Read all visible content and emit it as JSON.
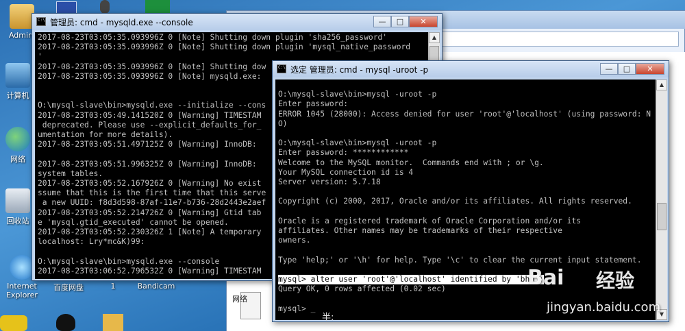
{
  "desktop": {
    "icons": [
      {
        "label": "Admini",
        "name": "desktop-icon-admin"
      },
      {
        "label": "计算机",
        "name": "desktop-icon-computer"
      },
      {
        "label": "网络",
        "name": "desktop-icon-network"
      },
      {
        "label": "回收站",
        "name": "desktop-icon-recycle-bin"
      },
      {
        "label": "Internet Explorer",
        "name": "desktop-icon-ie"
      },
      {
        "label": "百度网盘",
        "name": "desktop-icon-baidu-netdisk"
      },
      {
        "label": "1",
        "name": "desktop-icon-1"
      },
      {
        "label": "Bandicam",
        "name": "desktop-icon-bandicam"
      }
    ]
  },
  "explorer": {
    "file_label": "网络"
  },
  "window1": {
    "title": "管理员: cmd - mysqld.exe  --console",
    "lines": [
      "2017-08-23T03:05:35.093996Z 0 [Note] Shutting down plugin 'sha256_password'",
      "2017-08-23T03:05:35.093996Z 0 [Note] Shutting down plugin 'mysql_native_password",
      "'",
      "2017-08-23T03:05:35.093996Z 0 [Note] Shutting dow",
      "2017-08-23T03:05:35.093996Z 0 [Note] mysqld.exe:",
      "",
      "",
      "O:\\mysql-slave\\bin>mysqld.exe --initialize --cons",
      "2017-08-23T03:05:49.141520Z 0 [Warning] TIMESTAM",
      " deprecated. Please use --explicit_defaults_for_",
      "umentation for more details).",
      "2017-08-23T03:05:51.497125Z 0 [Warning] InnoDB: ",
      "",
      "2017-08-23T03:05:51.996325Z 0 [Warning] InnoDB: ",
      "system tables.",
      "2017-08-23T03:05:52.167926Z 0 [Warning] No exist",
      "ssume that this is the first time that this serve",
      " a new UUID: f8d3d598-87af-11e7-b736-28d2443e2aef",
      "2017-08-23T03:05:52.214726Z 0 [Warning] Gtid tab",
      "e 'mysql.gtid_executed' cannot be opened.",
      "2017-08-23T03:05:52.230326Z 1 [Note] A temporary",
      "localhost: Lry*mc&K)99:",
      "",
      "O:\\mysql-slave\\bin>mysqld.exe --console",
      "2017-08-23T03:06:52.796532Z 0 [Warning] TIMESTAM"
    ]
  },
  "window2": {
    "title": "选定 管理员: cmd - mysql  -uroot -p",
    "lines": [
      "",
      "O:\\mysql-slave\\bin>mysql -uroot -p",
      "Enter password:",
      "ERROR 1045 (28000): Access denied for user 'root'@'localhost' (using password: N",
      "O)",
      "",
      "O:\\mysql-slave\\bin>mysql -uroot -p",
      "Enter password: ************",
      "Welcome to the MySQL monitor.  Commands end with ; or \\g.",
      "Your MySQL connection id is 4",
      "Server version: 5.7.18",
      "",
      "Copyright (c) 2000, 2017, Oracle and/or its affiliates. All rights reserved.",
      "",
      "Oracle is a registered trademark of Oracle Corporation and/or its",
      "affiliates. Other names may be trademarks of their respective",
      "owners.",
      "",
      "Type 'help;' or '\\h' for help. Type '\\c' to clear the current input statement.",
      "",
      "mysql> alter user 'root'@'localhost' identified by 'bhb';",
      "Query OK, 0 rows affected (0.02 sec)",
      "",
      "mysql> _"
    ],
    "selected_line_index": 20
  },
  "ime": "半:",
  "watermark": {
    "brand": "Bai",
    "cn": "经验",
    "url": "jingyan.baidu.com"
  },
  "controls": {
    "minimize": "—",
    "maximize": "□",
    "close": "✕"
  }
}
